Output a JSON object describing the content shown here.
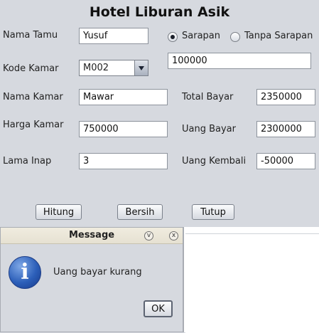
{
  "form": {
    "title": "Hotel Liburan Asik",
    "nama_tamu": {
      "label": "Nama Tamu",
      "value": "Yusuf"
    },
    "sarapan": {
      "options": [
        "Sarapan",
        "Tanpa Sarapan"
      ],
      "selected": "Sarapan",
      "price_value": "100000"
    },
    "kode_kamar": {
      "label": "Kode Kamar",
      "value": "M002"
    },
    "nama_kamar": {
      "label": "Nama Kamar",
      "value": "Mawar"
    },
    "harga_kamar": {
      "label": "Harga Kamar",
      "value": "750000"
    },
    "lama_inap": {
      "label": "Lama Inap",
      "value": "3"
    },
    "total_bayar": {
      "label": "Total Bayar",
      "value": "2350000"
    },
    "uang_bayar": {
      "label": "Uang Bayar",
      "value": "2300000"
    },
    "uang_kembali": {
      "label": "Uang Kembali",
      "value": "-50000"
    },
    "buttons": {
      "hitung": "Hitung",
      "bersih": "Bersih",
      "tutup": "Tutup"
    }
  },
  "dialog": {
    "title": "Message",
    "message": "Uang bayar kurang",
    "ok_label": "OK",
    "icon": "info-icon",
    "icon_glyph": "i",
    "minimize_glyph": "v",
    "close_glyph": "x"
  }
}
